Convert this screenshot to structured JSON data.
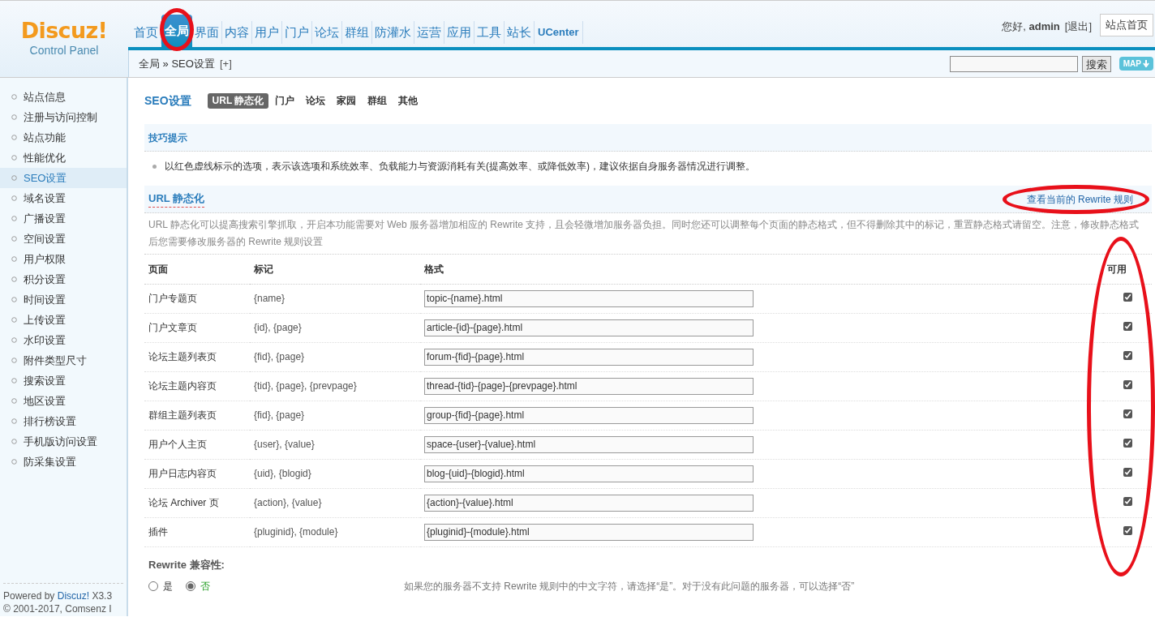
{
  "logo": {
    "title": "Discuz!",
    "subtitle": "Control Panel"
  },
  "nav": [
    {
      "label": "首页",
      "selected": false,
      "circled": false
    },
    {
      "label": "全局",
      "selected": true,
      "circled": true
    },
    {
      "label": "界面",
      "selected": false,
      "circled": false
    },
    {
      "label": "内容",
      "selected": false,
      "circled": false
    },
    {
      "label": "用户",
      "selected": false,
      "circled": false
    },
    {
      "label": "门户",
      "selected": false,
      "circled": false
    },
    {
      "label": "论坛",
      "selected": false,
      "circled": false
    },
    {
      "label": "群组",
      "selected": false,
      "circled": false
    },
    {
      "label": "防灌水",
      "selected": false,
      "circled": false
    },
    {
      "label": "运营",
      "selected": false,
      "circled": false
    },
    {
      "label": "应用",
      "selected": false,
      "circled": false
    },
    {
      "label": "工具",
      "selected": false,
      "circled": false
    },
    {
      "label": "站长",
      "selected": false,
      "circled": false
    },
    {
      "label": "UCenter",
      "selected": false,
      "circled": false
    }
  ],
  "user": {
    "greeting": "您好,",
    "name": "admin",
    "logout": "[退出]",
    "home": "站点首页"
  },
  "breadcrumb": {
    "path": "全局 » SEO设置",
    "add": "[+]"
  },
  "search": {
    "button": "搜索",
    "map": "MAP"
  },
  "sidebar": {
    "items": [
      {
        "label": "站点信息",
        "selected": false
      },
      {
        "label": "注册与访问控制",
        "selected": false
      },
      {
        "label": "站点功能",
        "selected": false
      },
      {
        "label": "性能优化",
        "selected": false
      },
      {
        "label": "SEO设置",
        "selected": true
      },
      {
        "label": "域名设置",
        "selected": false
      },
      {
        "label": "广播设置",
        "selected": false
      },
      {
        "label": "空间设置",
        "selected": false
      },
      {
        "label": "用户权限",
        "selected": false
      },
      {
        "label": "积分设置",
        "selected": false
      },
      {
        "label": "时间设置",
        "selected": false
      },
      {
        "label": "上传设置",
        "selected": false
      },
      {
        "label": "水印设置",
        "selected": false
      },
      {
        "label": "附件类型尺寸",
        "selected": false
      },
      {
        "label": "搜索设置",
        "selected": false
      },
      {
        "label": "地区设置",
        "selected": false
      },
      {
        "label": "排行榜设置",
        "selected": false
      },
      {
        "label": "手机版访问设置",
        "selected": false
      },
      {
        "label": "防采集设置",
        "selected": false
      }
    ],
    "footer": {
      "prefix": "Powered by",
      "brand": "Discuz!",
      "version": "X3.3",
      "copyright": "© 2001-2017, Comsenz I"
    }
  },
  "page_title": "SEO设置",
  "subtabs": [
    {
      "label": "URL 静态化",
      "selected": true
    },
    {
      "label": "门户",
      "selected": false
    },
    {
      "label": "论坛",
      "selected": false
    },
    {
      "label": "家园",
      "selected": false
    },
    {
      "label": "群组",
      "selected": false
    },
    {
      "label": "其他",
      "selected": false
    }
  ],
  "tips": {
    "title": "技巧提示",
    "items": [
      "以红色虚线标示的选项，表示该选项和系统效率、负载能力与资源消耗有关(提高效率、或降低效率)，建议依据自身服务器情况进行调整。"
    ]
  },
  "section": {
    "title": "URL 静态化",
    "link": "查看当前的 Rewrite 规则",
    "link_circled": true,
    "description": "URL 静态化可以提高搜索引擎抓取，开启本功能需要对 Web 服务器增加相应的 Rewrite 支持，且会轻微增加服务器负担。同时您还可以调整每个页面的静态格式，但不得删除其中的标记，重置静态格式请留空。注意，修改静态格式后您需要修改服务器的 Rewrite 规则设置"
  },
  "table": {
    "columns": [
      "页面",
      "标记",
      "格式",
      "可用"
    ],
    "enabled_circled": true,
    "rows": [
      {
        "page": "门户专题页",
        "marks": "{name}",
        "format": "topic-{name}.html",
        "checked": true
      },
      {
        "page": "门户文章页",
        "marks": "{id}, {page}",
        "format": "article-{id}-{page}.html",
        "checked": true
      },
      {
        "page": "论坛主题列表页",
        "marks": "{fid}, {page}",
        "format": "forum-{fid}-{page}.html",
        "checked": true
      },
      {
        "page": "论坛主题内容页",
        "marks": "{tid}, {page}, {prevpage}",
        "format": "thread-{tid}-{page}-{prevpage}.html",
        "checked": true
      },
      {
        "page": "群组主题列表页",
        "marks": "{fid}, {page}",
        "format": "group-{fid}-{page}.html",
        "checked": true
      },
      {
        "page": "用户个人主页",
        "marks": "{user}, {value}",
        "format": "space-{user}-{value}.html",
        "checked": true
      },
      {
        "page": "用户日志内容页",
        "marks": "{uid}, {blogid}",
        "format": "blog-{uid}-{blogid}.html",
        "checked": true
      },
      {
        "page": "论坛 Archiver 页",
        "marks": "{action}, {value}",
        "format": "{action}-{value}.html",
        "checked": true
      },
      {
        "page": "插件",
        "marks": "{pluginid}, {module}",
        "format": "{pluginid}-{module}.html",
        "checked": true
      }
    ]
  },
  "compat": {
    "label": "Rewrite 兼容性:",
    "options": [
      {
        "label": "是",
        "selected": false
      },
      {
        "label": "否",
        "selected": true
      }
    ],
    "hint": "如果您的服务器不支持 Rewrite 规则中的中文字符，请选择“是”。对于没有此问题的服务器，可以选择“否”"
  }
}
